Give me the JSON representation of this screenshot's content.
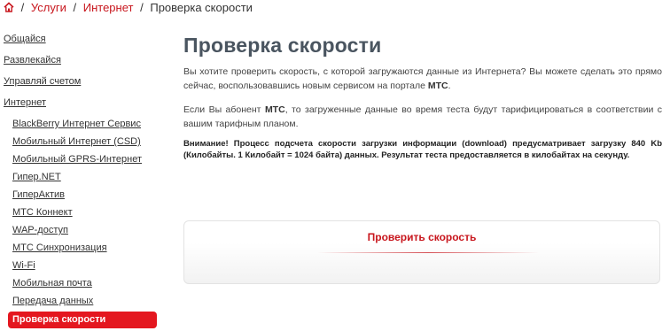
{
  "breadcrumb": {
    "home_icon": "home-icon",
    "items": [
      "Услуги",
      "Интернет"
    ],
    "separator": "/",
    "current": "Проверка скорости"
  },
  "sidebar": {
    "top": [
      "Общайся",
      "Развлекайся",
      "Управляй счетом",
      "Интернет"
    ],
    "sub": [
      "BlackBerry Интернет Сервис",
      "Мобильный Интернет (CSD)",
      "Мобильный GPRS-Интернет",
      "Гипер.NET",
      "ГиперАктив",
      "МТС Коннект",
      "WAP-доступ",
      "МТС Синхронизация",
      "Wi-Fi",
      "Мобильная почта",
      "Передача данных"
    ],
    "active": "Проверка скорости"
  },
  "main": {
    "title": "Проверка скорости",
    "p1_text": "Вы хотите проверить скорость, с которой загружаются данные из Интернета? Вы можете сделать это прямо сейчас, воспользовавшись новым сервисом на портале",
    "p1_bold": "МТС",
    "p1_end": ".",
    "p2_start": "Если Вы абонент",
    "p2_bold": "МТС",
    "p2_end": ", то загруженные данные во время теста будут тарифицироваться в соответствии с вашим тарифным планом.",
    "note": "Внимание! Процесс подсчета скорости загрузки информации (download) предусматривает загрузку 840 Kb (Килобайты. 1 Килобайт = 1024 байта) данных. Результат теста предоставляется в килобайтах на секунду.",
    "check_button": "Проверить скорость"
  },
  "colors": {
    "accent": "#c8161d",
    "active_bg": "#e4171f",
    "title": "#4a5560",
    "text": "#444444"
  }
}
